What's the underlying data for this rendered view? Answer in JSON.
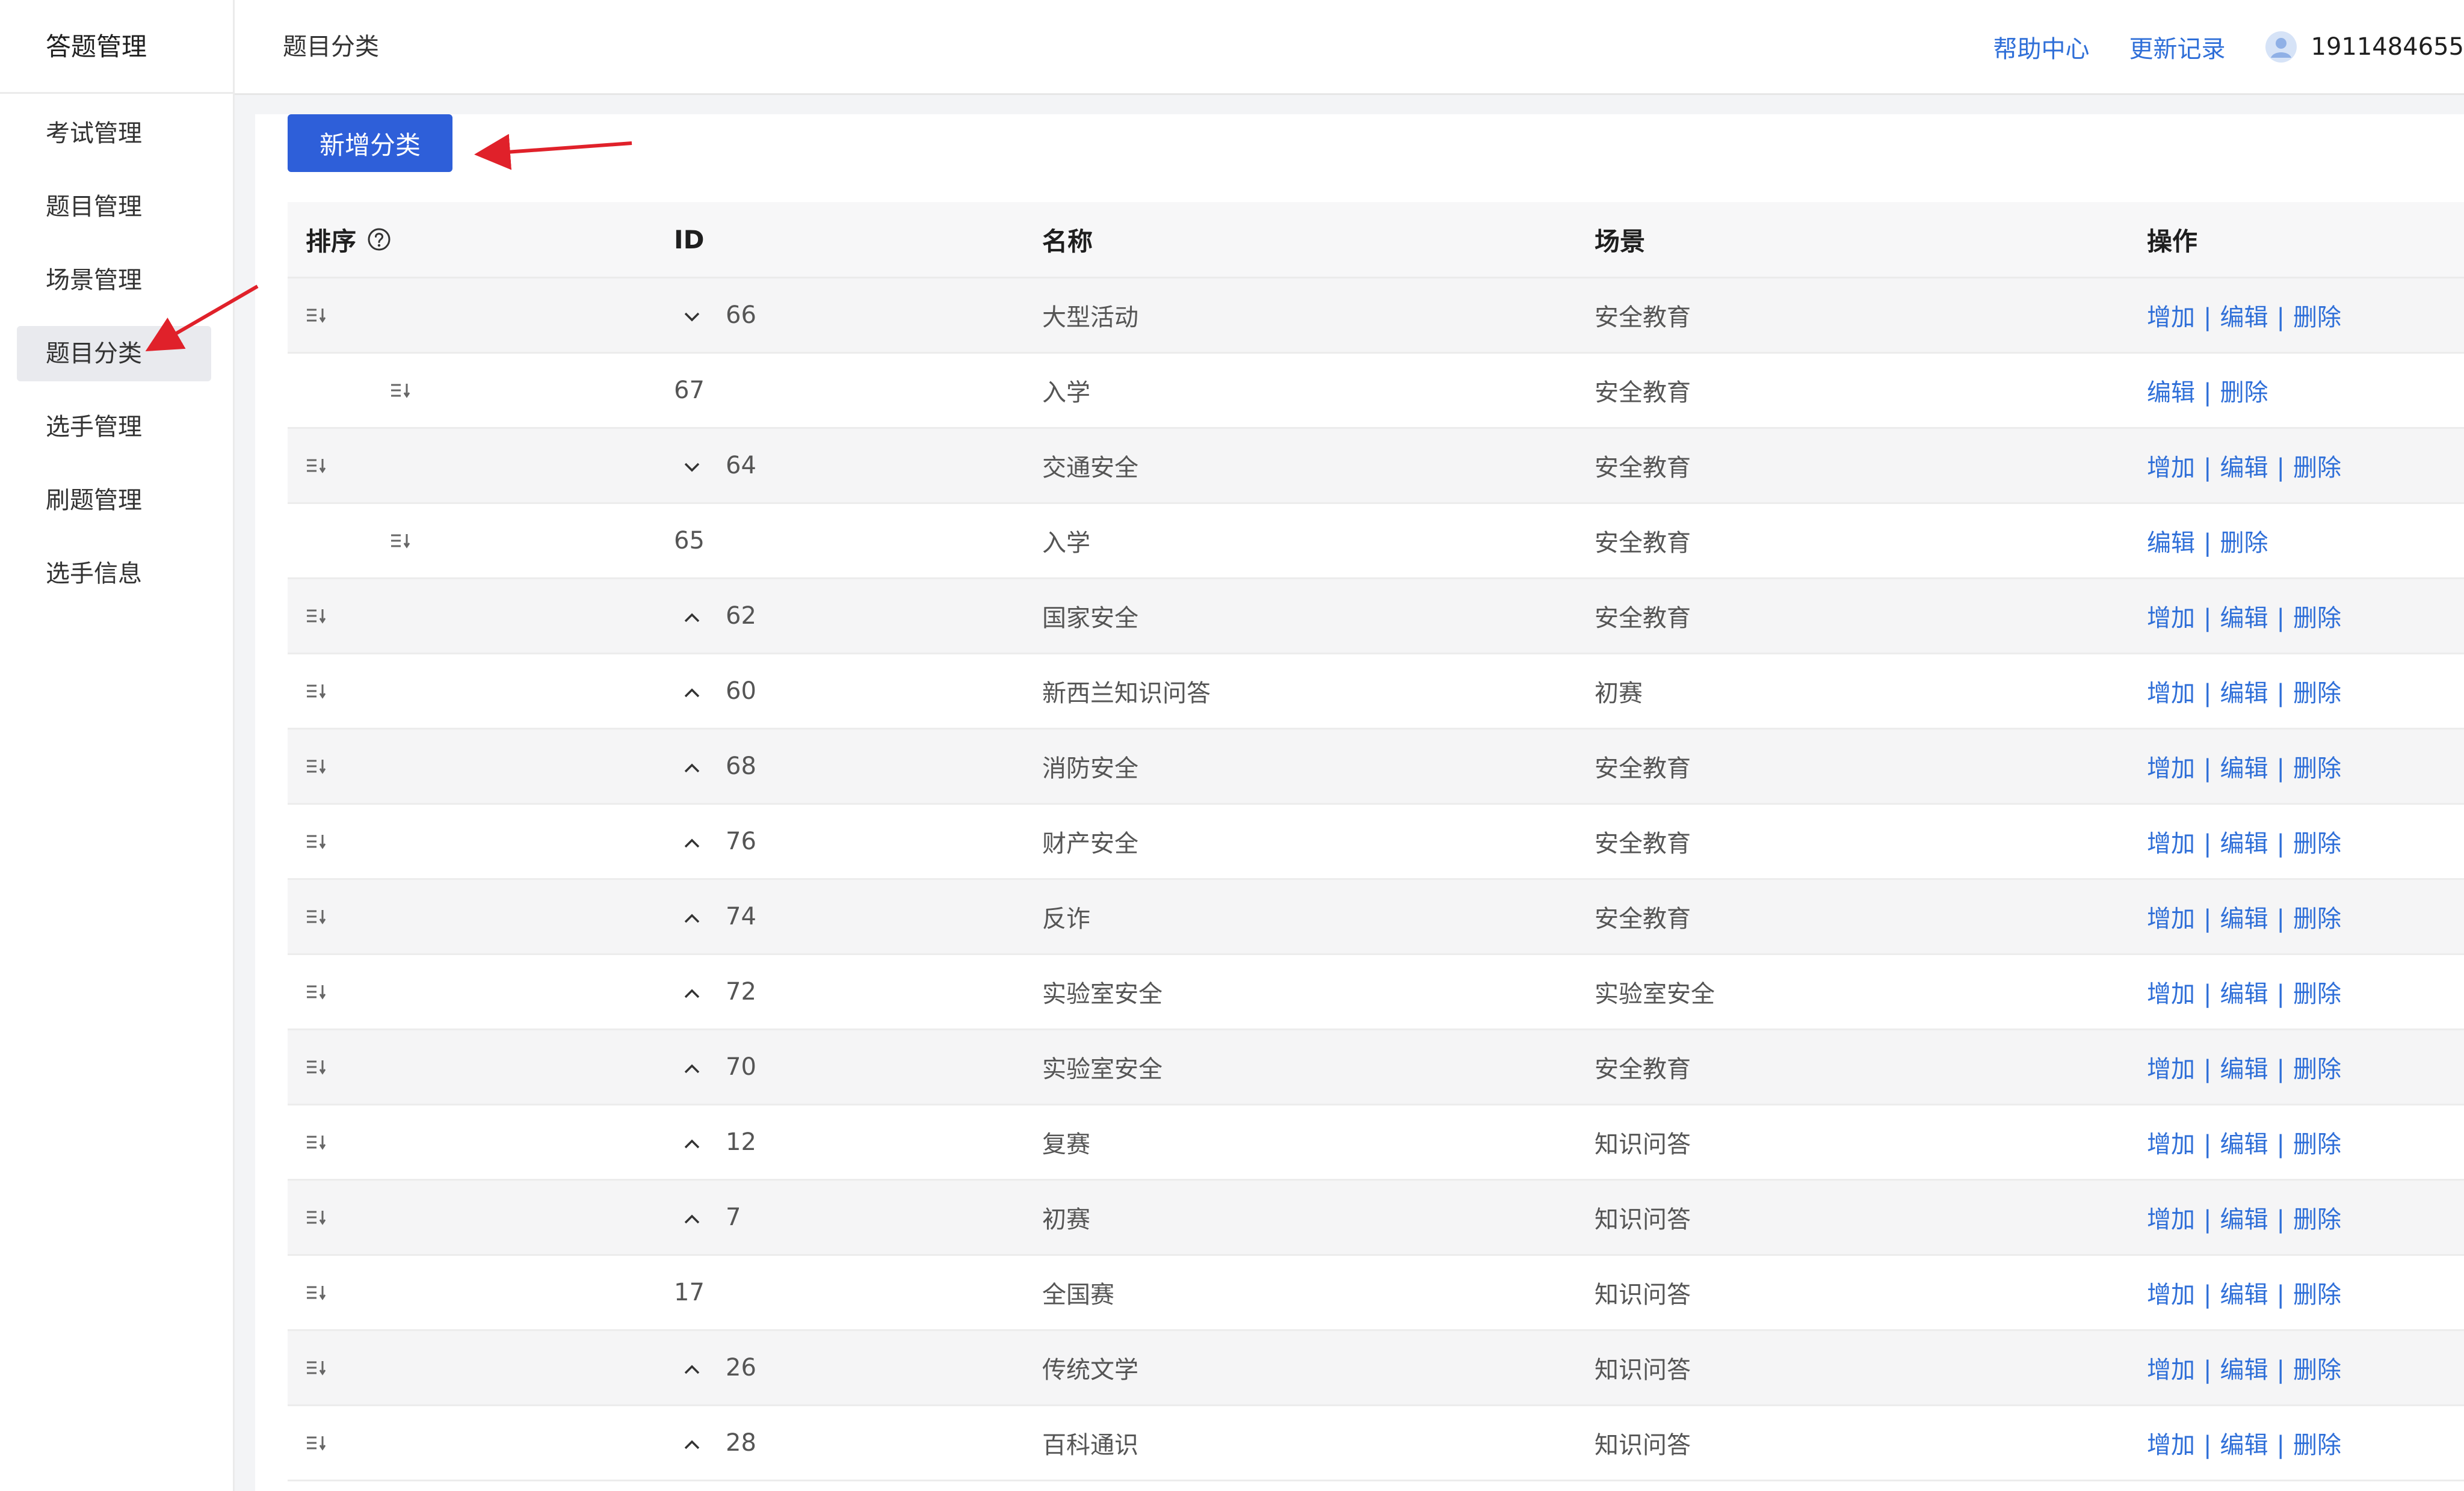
{
  "sidebar": {
    "title": "答题管理",
    "items": [
      {
        "label": "考试管理",
        "active": false
      },
      {
        "label": "题目管理",
        "active": false
      },
      {
        "label": "场景管理",
        "active": false
      },
      {
        "label": "题目分类",
        "active": true
      },
      {
        "label": "选手管理",
        "active": false
      },
      {
        "label": "刷题管理",
        "active": false
      },
      {
        "label": "选手信息",
        "active": false
      }
    ]
  },
  "header": {
    "title": "题目分类",
    "help_label": "帮助中心",
    "changelog_label": "更新记录",
    "user_name": "1911484655"
  },
  "toolbar": {
    "add_label": "新增分类"
  },
  "table": {
    "columns": {
      "sort": "排序",
      "id": "ID",
      "name": "名称",
      "scene": "场景",
      "ops": "操作"
    },
    "op_labels": {
      "add": "增加",
      "edit": "编辑",
      "delete": "删除"
    },
    "rows": [
      {
        "id": "66",
        "name": "大型活动",
        "scene": "安全教育",
        "expand": "down",
        "child": false
      },
      {
        "id": "67",
        "name": "入学",
        "scene": "安全教育",
        "expand": "none",
        "child": true
      },
      {
        "id": "64",
        "name": "交通安全",
        "scene": "安全教育",
        "expand": "down",
        "child": false
      },
      {
        "id": "65",
        "name": "入学",
        "scene": "安全教育",
        "expand": "none",
        "child": true
      },
      {
        "id": "62",
        "name": "国家安全",
        "scene": "安全教育",
        "expand": "up",
        "child": false
      },
      {
        "id": "60",
        "name": "新西兰知识问答",
        "scene": "初赛",
        "expand": "up",
        "child": false
      },
      {
        "id": "68",
        "name": "消防安全",
        "scene": "安全教育",
        "expand": "up",
        "child": false
      },
      {
        "id": "76",
        "name": "财产安全",
        "scene": "安全教育",
        "expand": "up",
        "child": false
      },
      {
        "id": "74",
        "name": "反诈",
        "scene": "安全教育",
        "expand": "up",
        "child": false
      },
      {
        "id": "72",
        "name": "实验室安全",
        "scene": "实验室安全",
        "expand": "up",
        "child": false
      },
      {
        "id": "70",
        "name": "实验室安全",
        "scene": "安全教育",
        "expand": "up",
        "child": false
      },
      {
        "id": "12",
        "name": "复赛",
        "scene": "知识问答",
        "expand": "up",
        "child": false
      },
      {
        "id": "7",
        "name": "初赛",
        "scene": "知识问答",
        "expand": "up",
        "child": false
      },
      {
        "id": "17",
        "name": "全国赛",
        "scene": "知识问答",
        "expand": "none",
        "child": false
      },
      {
        "id": "26",
        "name": "传统文学",
        "scene": "知识问答",
        "expand": "up",
        "child": false
      },
      {
        "id": "28",
        "name": "百科通识",
        "scene": "知识问答",
        "expand": "up",
        "child": false
      }
    ]
  },
  "colors": {
    "accent": "#2e5fd9",
    "link": "#2f6fd8",
    "annotation": "#e0212a"
  }
}
